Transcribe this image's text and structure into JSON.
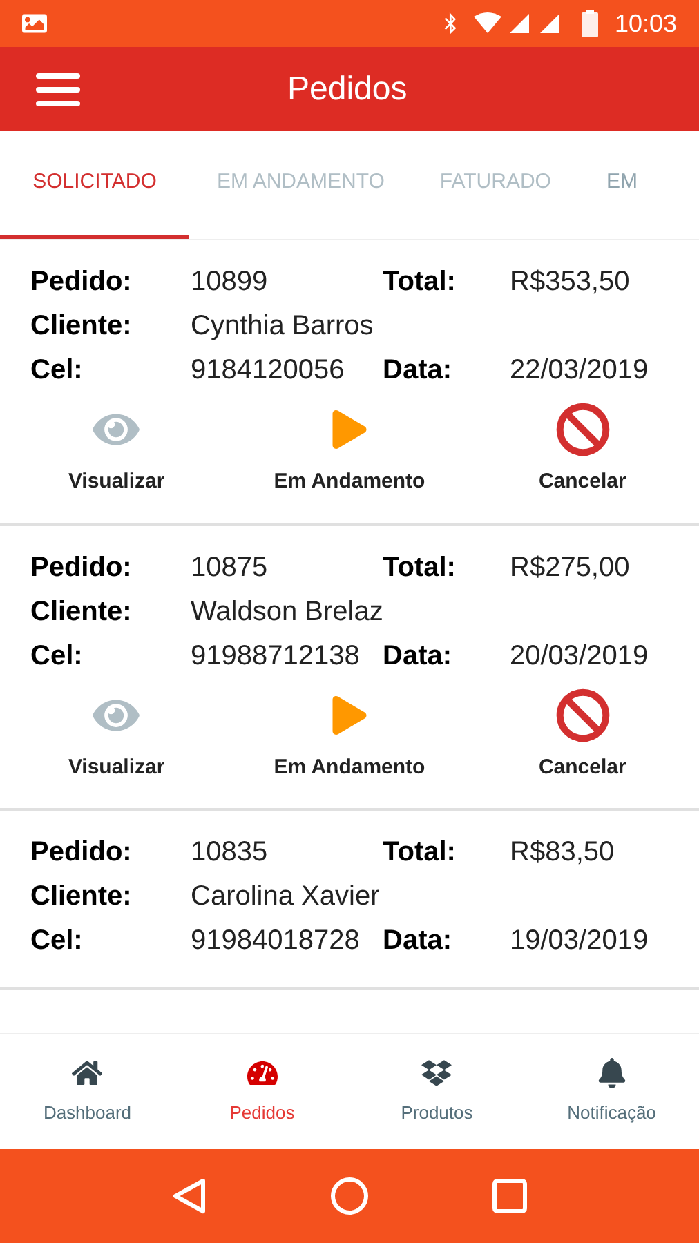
{
  "status_bar": {
    "time": "10:03"
  },
  "app_bar": {
    "title": "Pedidos"
  },
  "tabs": [
    {
      "label": "SOLICITADO",
      "selected": true
    },
    {
      "label": "EM ANDAMENTO",
      "selected": false
    },
    {
      "label": "FATURADO",
      "selected": false
    },
    {
      "label": "EM",
      "selected": false
    }
  ],
  "orders": [
    {
      "fields": [
        {
          "label": "Pedido:",
          "value": "10899"
        },
        {
          "label": "Total:",
          "value": "R$353,50"
        },
        {
          "label": "Cliente:",
          "value": "Cynthia Barros"
        },
        {
          "label": "Cel:",
          "value": "9184120056"
        },
        {
          "label": "Data:",
          "value": "22/03/2019"
        }
      ],
      "actions": [
        {
          "kind": "view",
          "label": "Visualizar"
        },
        {
          "kind": "progress",
          "label": "Em Andamento"
        },
        {
          "kind": "cancel",
          "label": "Cancelar"
        }
      ]
    },
    {
      "fields": [
        {
          "label": "Pedido:",
          "value": "10875"
        },
        {
          "label": "Total:",
          "value": "R$275,00"
        },
        {
          "label": "Cliente:",
          "value": "Waldson Brelaz"
        },
        {
          "label": "Cel:",
          "value": "91988712138"
        },
        {
          "label": "Data:",
          "value": "20/03/2019"
        }
      ],
      "actions": [
        {
          "kind": "view",
          "label": "Visualizar"
        },
        {
          "kind": "progress",
          "label": "Em Andamento"
        },
        {
          "kind": "cancel",
          "label": "Cancelar"
        }
      ]
    },
    {
      "fields": [
        {
          "label": "Pedido:",
          "value": "10835"
        },
        {
          "label": "Total:",
          "value": "R$83,50"
        },
        {
          "label": "Cliente:",
          "value": "Carolina  Xavier"
        },
        {
          "label": "Cel:",
          "value": "91984018728"
        },
        {
          "label": "Data:",
          "value": "19/03/2019"
        }
      ]
    }
  ],
  "bottom_nav": [
    {
      "kind": "home",
      "label": "Dashboard",
      "selected": false
    },
    {
      "kind": "gauge",
      "label": "Pedidos",
      "selected": true
    },
    {
      "kind": "box",
      "label": "Produtos",
      "selected": false
    },
    {
      "kind": "bell",
      "label": "Notificação",
      "selected": false
    }
  ]
}
